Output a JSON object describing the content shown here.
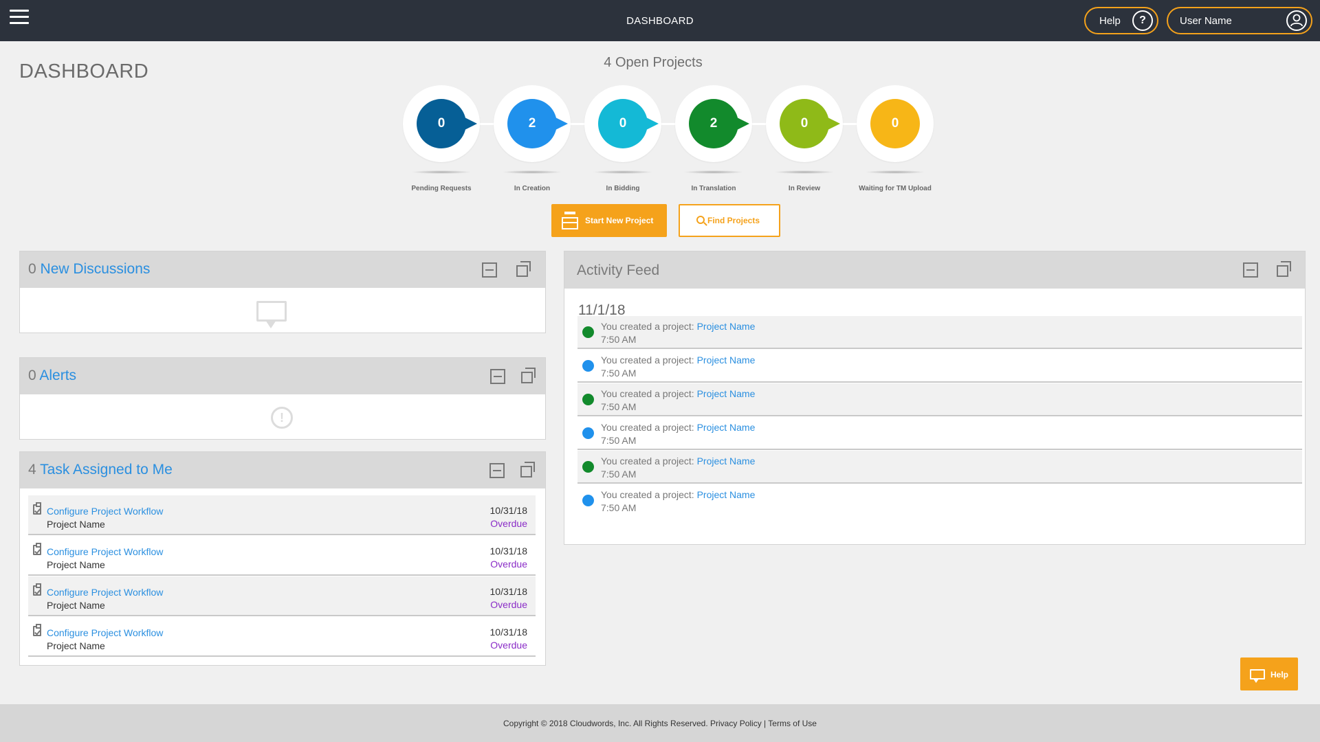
{
  "header": {
    "title": "DASHBOARD",
    "help_label": "Help",
    "help_icon": "?",
    "user_label": "User Name"
  },
  "page": {
    "title": "DASHBOARD"
  },
  "pipeline": {
    "summary": "4 Open Projects",
    "stages": [
      {
        "count": "0",
        "label": "Pending Requests",
        "color": "#065f96"
      },
      {
        "count": "2",
        "label": "In Creation",
        "color": "#2091ec"
      },
      {
        "count": "0",
        "label": "In Bidding",
        "color": "#14b9d6"
      },
      {
        "count": "2",
        "label": "In Translation",
        "color": "#128a2c"
      },
      {
        "count": "0",
        "label": "In Review",
        "color": "#8fba18"
      },
      {
        "count": "0",
        "label": "Waiting for TM Upload",
        "color": "#f7b617"
      }
    ]
  },
  "actions": {
    "start_label": "Start New Project",
    "find_label": "Find Projects"
  },
  "discussions": {
    "count": "0",
    "title": "New Discussions"
  },
  "alerts": {
    "count": "0",
    "title": "Alerts",
    "icon_glyph": "!"
  },
  "tasks": {
    "count": "4",
    "title": "Task Assigned to Me",
    "items": [
      {
        "name": "Configure Project Workflow",
        "project": "Project Name",
        "date": "10/31/18",
        "status": "Overdue"
      },
      {
        "name": "Configure Project Workflow",
        "project": "Project Name",
        "date": "10/31/18",
        "status": "Overdue"
      },
      {
        "name": "Configure Project Workflow",
        "project": "Project Name",
        "date": "10/31/18",
        "status": "Overdue"
      },
      {
        "name": "Configure Project Workflow",
        "project": "Project Name",
        "date": "10/31/18",
        "status": "Overdue"
      }
    ]
  },
  "activity": {
    "title": "Activity Feed",
    "date": "11/1/18",
    "items": [
      {
        "text": "You created a project: ",
        "link": "Project Name",
        "time": "7:50 AM",
        "dot_color": "#128a2c"
      },
      {
        "text": "You created a project: ",
        "link": "Project Name",
        "time": "7:50 AM",
        "dot_color": "#2091ec"
      },
      {
        "text": "You created a project: ",
        "link": "Project Name",
        "time": "7:50 AM",
        "dot_color": "#128a2c"
      },
      {
        "text": "You created a project: ",
        "link": "Project Name",
        "time": "7:50 AM",
        "dot_color": "#2091ec"
      },
      {
        "text": "You created a project: ",
        "link": "Project Name",
        "time": "7:50 AM",
        "dot_color": "#128a2c"
      },
      {
        "text": "You created a project: ",
        "link": "Project Name",
        "time": "7:50 AM",
        "dot_color": "#2091ec"
      }
    ]
  },
  "float_help": {
    "label": "Help"
  },
  "footer": {
    "copyright": "Copyright © 2018 Cloudwords, Inc. All Rights Reserved.",
    "privacy": "Privacy Policy",
    "separator": "|",
    "terms": "Terms of Use"
  },
  "colors": {
    "accent": "#f5a21b",
    "link": "#2a8fe0",
    "overdue": "#8a2cc7",
    "header_bg": "#2c323c"
  }
}
